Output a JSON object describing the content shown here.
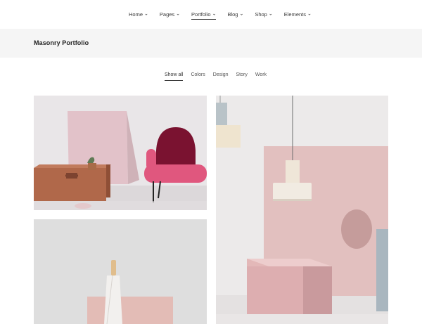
{
  "nav": {
    "items": [
      {
        "label": "Home"
      },
      {
        "label": "Pages"
      },
      {
        "label": "Portfolio"
      },
      {
        "label": "Blog"
      },
      {
        "label": "Shop"
      },
      {
        "label": "Elements"
      }
    ],
    "active_index": 2,
    "chevron_icon": "chevron-down-icon"
  },
  "header": {
    "title": "Masonry Portfolio"
  },
  "filters": {
    "items": [
      {
        "label": "Show all"
      },
      {
        "label": "Colors"
      },
      {
        "label": "Design"
      },
      {
        "label": "Story"
      },
      {
        "label": "Work"
      }
    ],
    "active_index": 0
  },
  "colors": {
    "title_band": "#f5f5f5",
    "text": "#222222",
    "pink_panel": "#e8c4c4",
    "terracotta": "#b0684a",
    "chair_red": "#7a1230"
  }
}
